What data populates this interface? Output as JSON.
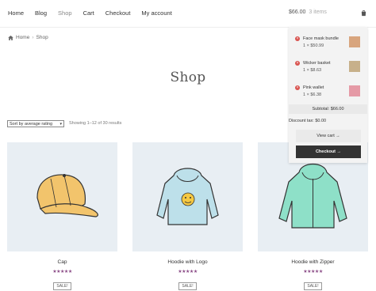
{
  "nav": {
    "items": [
      "Home",
      "Blog",
      "Shop",
      "Cart",
      "Checkout",
      "My account"
    ]
  },
  "header_cart": {
    "amount": "$66.00",
    "items_label": "3 items"
  },
  "breadcrumb": {
    "home": "Home",
    "separator": "›",
    "current": "Shop"
  },
  "page_title": "Shop",
  "sort": {
    "selected": "Sort by average rating"
  },
  "showing": "Showing 1–12 of 30 results",
  "products": [
    {
      "name": "Cap",
      "stars": "★★★★★",
      "badge": "SALE!"
    },
    {
      "name": "Hoodie with Logo",
      "stars": "★★★★★",
      "badge": "SALE!"
    },
    {
      "name": "Hoodie with Zipper",
      "stars": "★★★★★",
      "badge": "SALE!"
    }
  ],
  "mini_cart": {
    "items": [
      {
        "name": "Face mask bundle",
        "qty": "1 × $50.99"
      },
      {
        "name": "Wicker basket",
        "qty": "1 × $8.63"
      },
      {
        "name": "Pink wallet",
        "qty": "1 × $6.38"
      }
    ],
    "subtotal": "Subtotal: $66.00",
    "tax": "Discount tax: $0.00",
    "view_cart": "View cart →",
    "checkout": "Checkout →"
  },
  "colors": {
    "accent_star": "#8a4b86",
    "remove_icon": "#d9534f",
    "checkout_bg": "#333333"
  }
}
